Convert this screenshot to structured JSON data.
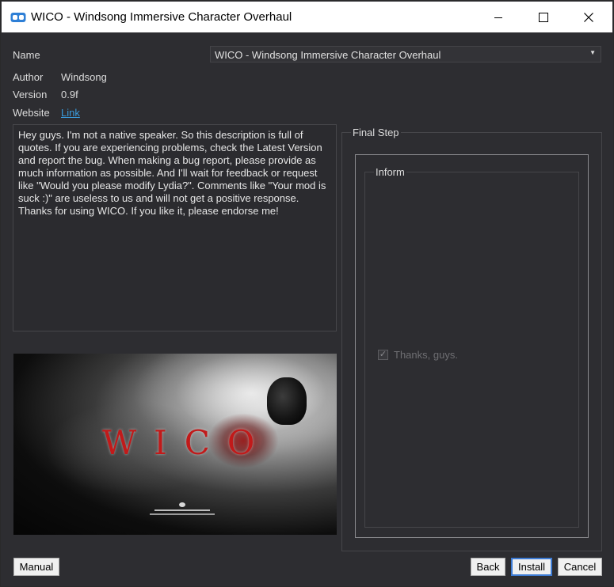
{
  "window": {
    "title": "WICO - Windsong Immersive Character Overhaul",
    "icon": "app-icon",
    "controls": {
      "minimize_glyph": "—",
      "maximize_glyph": "☐",
      "close_glyph": "✕"
    }
  },
  "info": {
    "name_label": "Name",
    "name_value": "WICO - Windsong Immersive Character Overhaul",
    "author_label": "Author",
    "author_value": "Windsong",
    "version_label": "Version",
    "version_value": "0.9f",
    "website_label": "Website",
    "website_link": "Link"
  },
  "description": "Hey guys. I'm not a native speaker. So this description is full of\nquotes. If you are experiencing problems, check the Latest Version\nand report the bug. When making a bug report, please provide as\nmuch information as possible. And I'll wait for feedback or request\nlike \"Would you please modify Lydia?\". Comments like \"Your mod is\nsuck :)\" are useless to us and will not get a positive response.\nThanks for using WICO. If you like it, please endorse me!",
  "banner": {
    "logo_text": "WICO"
  },
  "step": {
    "title": "Final Step",
    "group_title": "Inform",
    "option_label": "Thanks, guys.",
    "option_checked": true
  },
  "buttons": {
    "manual": "Manual",
    "back": "Back",
    "install": "Install",
    "cancel": "Cancel"
  },
  "colors": {
    "background": "#2d2d31",
    "link": "#3a9bdc",
    "accent_blood": "#c11a1a"
  }
}
